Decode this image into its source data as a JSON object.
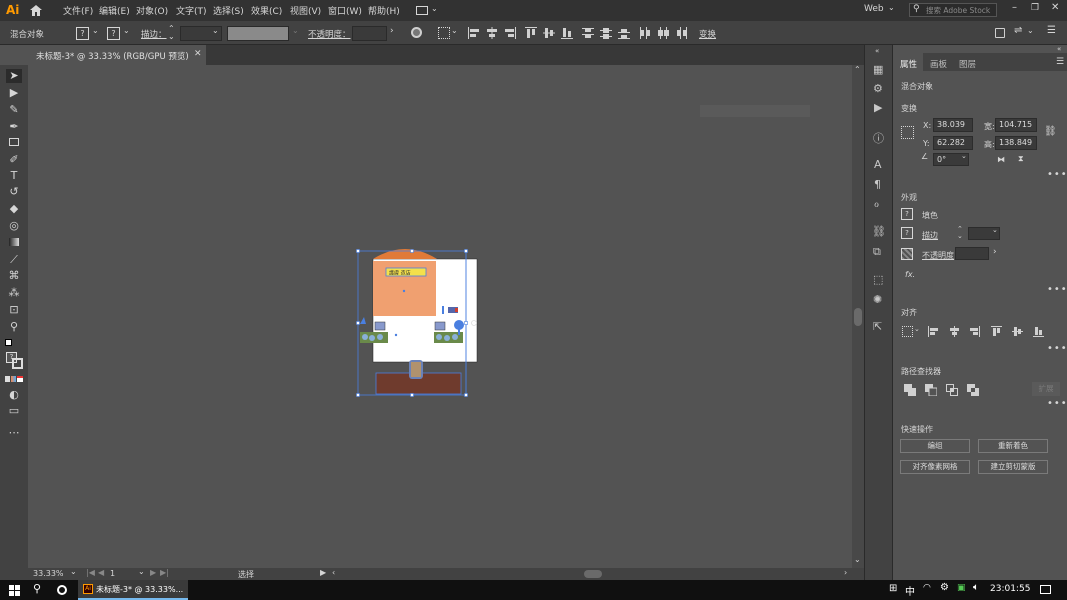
{
  "app": {
    "logo": "Ai",
    "menus": [
      "文件(F)",
      "编辑(E)",
      "对象(O)",
      "文字(T)",
      "选择(S)",
      "效果(C)",
      "视图(V)",
      "窗口(W)",
      "帮助(H)"
    ],
    "workspace": "Web",
    "search_placeholder": "搜索 Adobe Stock"
  },
  "control_bar": {
    "object_type": "混合对象",
    "stroke_label": "描边：",
    "opacity_label": "不透明度：",
    "transform_label": "变换"
  },
  "document": {
    "tab_title": "未标题-3* @ 33.33% (RGB/GPU 预览)",
    "sign_text": "護膚 造店"
  },
  "status_bar": {
    "zoom": "33.33%",
    "artboard": "1",
    "tool": "选择"
  },
  "panel": {
    "tabs": [
      "属性",
      "画板",
      "图层"
    ],
    "object_type": "混合对象",
    "transform": {
      "title": "变换",
      "x_label": "X:",
      "x_value": "38.039 ",
      "y_label": "Y:",
      "y_value": "62.282 ",
      "w_label": "宽:",
      "w_value": "104.715",
      "h_label": "高:",
      "h_value": "138.849",
      "angle_value": "0°"
    },
    "appearance": {
      "title": "外观",
      "fill_label": "填色",
      "stroke_label": "描边",
      "opacity_label": "不透明度",
      "fx_label": "fx."
    },
    "align": {
      "title": "对齐"
    },
    "pathfinder": {
      "title": "路径查找器",
      "expand_label": "扩展"
    },
    "quick_actions": {
      "title": "快速操作",
      "buttons": [
        "编组",
        "重新着色",
        "对齐像素网格",
        "建立剪切蒙版"
      ]
    }
  },
  "taskbar": {
    "doc_label": "未标题-3* @ 33.33%...",
    "ime_mode": "中",
    "time": "23:01:55"
  },
  "colors": {
    "accent": "#2680eb",
    "selection": "#4a7fe0",
    "roof": "#e07a38",
    "shop_wall": "#f0a070",
    "base": "#6f3b2d",
    "sign": "#f4e04a"
  }
}
